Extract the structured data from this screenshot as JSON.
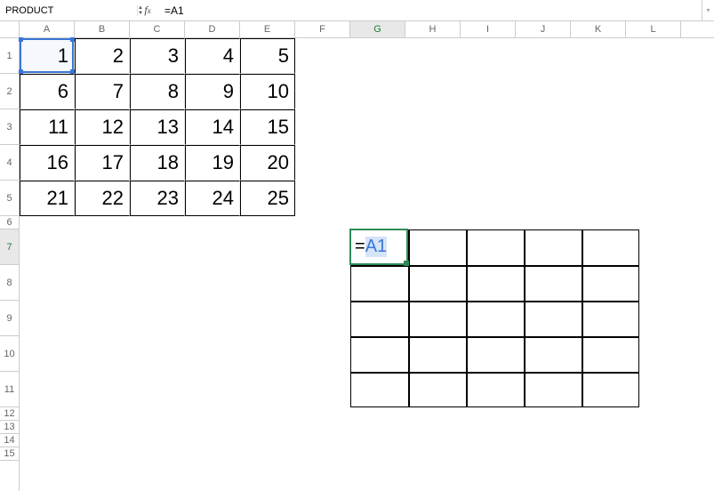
{
  "nameBox": "PRODUCT",
  "formula": "=A1",
  "columns": [
    "A",
    "B",
    "C",
    "D",
    "E",
    "F",
    "G",
    "H",
    "I",
    "J",
    "K",
    "L"
  ],
  "rows": [
    "1",
    "2",
    "3",
    "4",
    "5",
    "6",
    "7",
    "8",
    "9",
    "10",
    "11",
    "12",
    "13",
    "14",
    "15"
  ],
  "bigRows": 5,
  "mediumRowsStart": 6,
  "mediumRowsEnd": 11,
  "activeCol": "G",
  "activeRow": "7",
  "table1": [
    [
      "1",
      "2",
      "3",
      "4",
      "5"
    ],
    [
      "6",
      "7",
      "8",
      "9",
      "10"
    ],
    [
      "11",
      "12",
      "13",
      "14",
      "15"
    ],
    [
      "16",
      "17",
      "18",
      "19",
      "20"
    ],
    [
      "21",
      "22",
      "23",
      "24",
      "25"
    ]
  ],
  "editCell": {
    "eq": "=",
    "ref": "A1"
  },
  "chart_data": {
    "type": "table",
    "title": "5x5 sequential integers grid",
    "values": [
      [
        1,
        2,
        3,
        4,
        5
      ],
      [
        6,
        7,
        8,
        9,
        10
      ],
      [
        11,
        12,
        13,
        14,
        15
      ],
      [
        16,
        17,
        18,
        19,
        20
      ],
      [
        21,
        22,
        23,
        24,
        25
      ]
    ]
  }
}
